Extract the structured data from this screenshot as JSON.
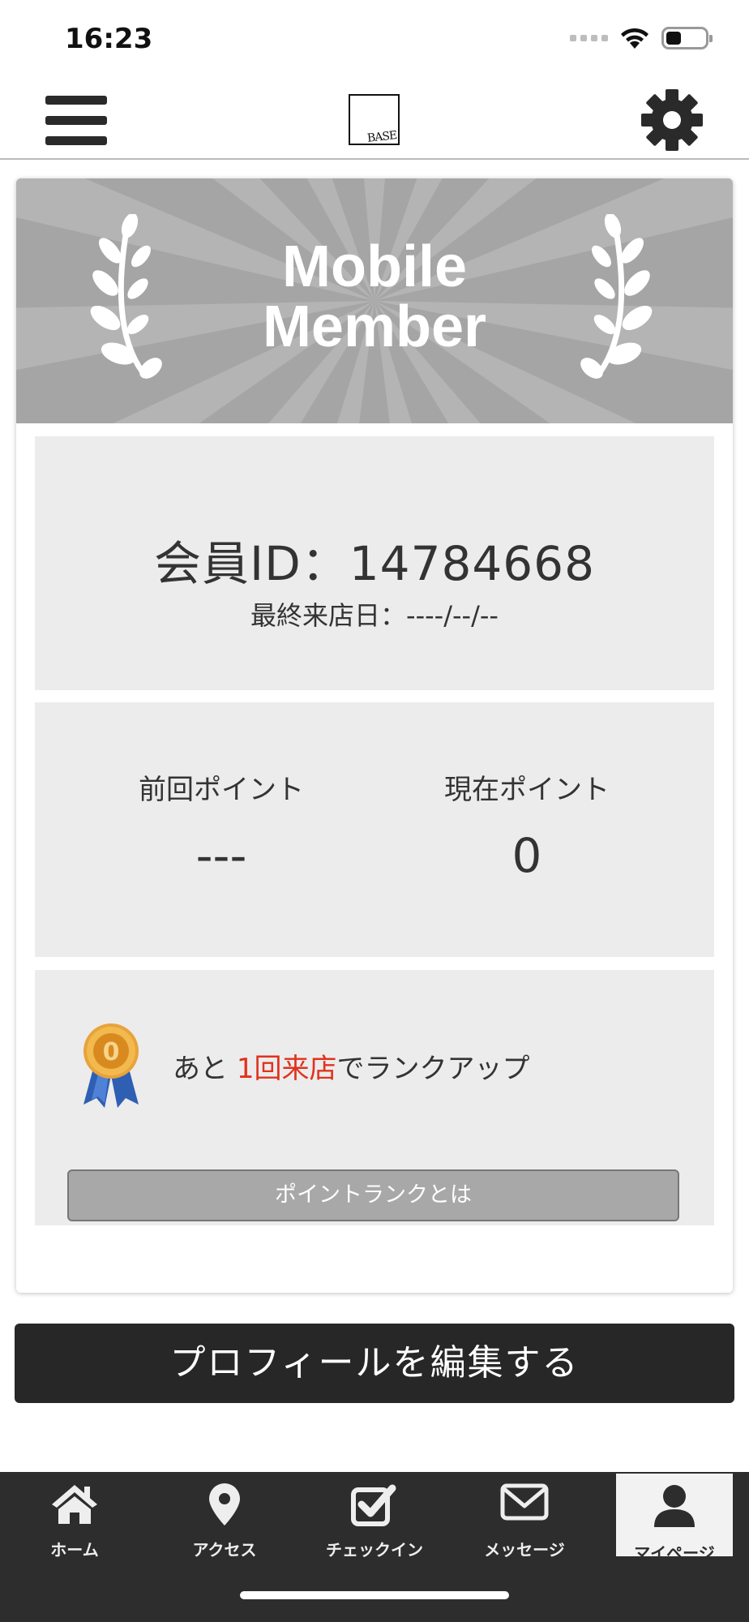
{
  "status_bar": {
    "time": "16:23",
    "icons": [
      "signal-icon",
      "wifi-icon",
      "battery-icon"
    ]
  },
  "header": {
    "menu_icon": "hamburger-menu-icon",
    "logo_text": "BASE",
    "settings_icon": "gear-icon"
  },
  "member_card": {
    "banner_line1": "Mobile",
    "banner_line2": "Member",
    "member_id": "会員ID：14784668",
    "last_visit": "最終来店日：----/--/--",
    "previous_points_label": "前回ポイント",
    "previous_points_value": "---",
    "current_points_label": "現在ポイント",
    "current_points_value": "0",
    "rank_prefix": "あと",
    "rank_highlight": "1回来店",
    "rank_suffix": "でランクアップ",
    "rank_medal_number": "0",
    "rank_button_label": "ポイントランクとは"
  },
  "edit_profile_label": "プロフィールを編集する",
  "bottom_nav": {
    "items": [
      {
        "label": "ホーム",
        "icon": "home-icon"
      },
      {
        "label": "アクセス",
        "icon": "map-pin-icon"
      },
      {
        "label": "チェックイン",
        "icon": "checkbox-icon"
      },
      {
        "label": "メッセージ",
        "icon": "envelope-icon"
      },
      {
        "label": "マイページ",
        "icon": "user-icon"
      }
    ],
    "active_index": 4
  },
  "colors": {
    "highlight": "#e1321e",
    "banner": "#a5a5a5",
    "panel": "#ececec",
    "dark": "#272727",
    "nav_background": "#2d2d2d",
    "medal_gold": "#e8a33a",
    "ribbon_blue": "#2f5fb3"
  }
}
